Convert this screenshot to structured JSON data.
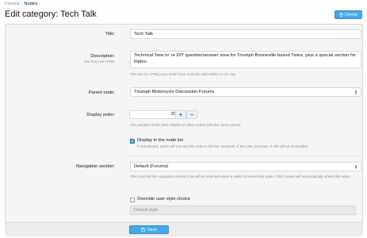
{
  "breadcrumb": {
    "items": [
      "Forums",
      "Nodes"
    ],
    "separator": "›"
  },
  "page_title": "Edit category: Tech Talk",
  "delete_button": {
    "icon": "trash-icon",
    "label": "Delete"
  },
  "form": {
    "title": {
      "label": "Title:",
      "value": "Tech Talk"
    },
    "description": {
      "label": "Description:",
      "sublabel": "You may use HTML",
      "value": "Technical 'how to' or DIY question/answer area for Triumph Bonneville based Twins, plus a special section for triples.",
      "hint": "The text (or HTML) you insert here must be valid within a <p> tag."
    },
    "parent_node": {
      "label": "Parent node:",
      "value": "Triumph Motorcycle Discussion Forums"
    },
    "display_order": {
      "label": "Display order:",
      "value": "20",
      "plus": "+",
      "minus": "−",
      "hint": "The position of this item relative to other nodes with the same parent."
    },
    "display_in_list": {
      "label": "Display in the node list",
      "checked": true,
      "hint": "If unselected, users will not see this node in the list. However, if the URL is known, it will still be accessible."
    },
    "navigation_section": {
      "label": "Navigation section:",
      "value": "Default (Forums)",
      "hint": "This controls the navigation section that will be selected when a visitor browses this node. Child nodes will automatically inherit this value."
    },
    "override_style": {
      "label": "Override user style choice",
      "checked": false,
      "select_value": "Default style"
    }
  },
  "save_button": {
    "icon": "save-icon",
    "label": "Save"
  },
  "colors": {
    "accent": "#47a7eb",
    "link": "#2d5c8a"
  }
}
